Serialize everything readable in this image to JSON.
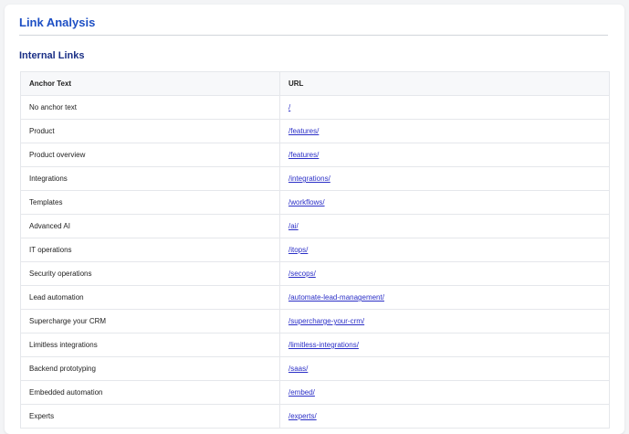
{
  "header": {
    "title": "Link Analysis"
  },
  "internal_links": {
    "title": "Internal Links",
    "columns": [
      "Anchor Text",
      "URL"
    ],
    "rows": [
      {
        "anchor": "No anchor text",
        "url": "/"
      },
      {
        "anchor": "Product",
        "url": "/features/"
      },
      {
        "anchor": "Product overview",
        "url": "/features/"
      },
      {
        "anchor": "Integrations",
        "url": "/integrations/"
      },
      {
        "anchor": "Templates",
        "url": "/workflows/"
      },
      {
        "anchor": "Advanced AI",
        "url": "/ai/"
      },
      {
        "anchor": "IT operations",
        "url": "/itops/"
      },
      {
        "anchor": "Security operations",
        "url": "/secops/"
      },
      {
        "anchor": "Lead automation",
        "url": "/automate-lead-management/"
      },
      {
        "anchor": "Supercharge your CRM",
        "url": "/supercharge-your-crm/"
      },
      {
        "anchor": "Limitless integrations",
        "url": "/limitless-integrations/"
      },
      {
        "anchor": "Backend prototyping",
        "url": "/saas/"
      },
      {
        "anchor": "Embedded automation",
        "url": "/embed/"
      },
      {
        "anchor": "Experts",
        "url": "/experts/"
      }
    ]
  },
  "colors": {
    "title": "#1d4fc4",
    "subtitle": "#1a2f86",
    "link": "#2b2fc7",
    "header_bg": "#f7f8fa",
    "border": "#e5e7eb"
  }
}
